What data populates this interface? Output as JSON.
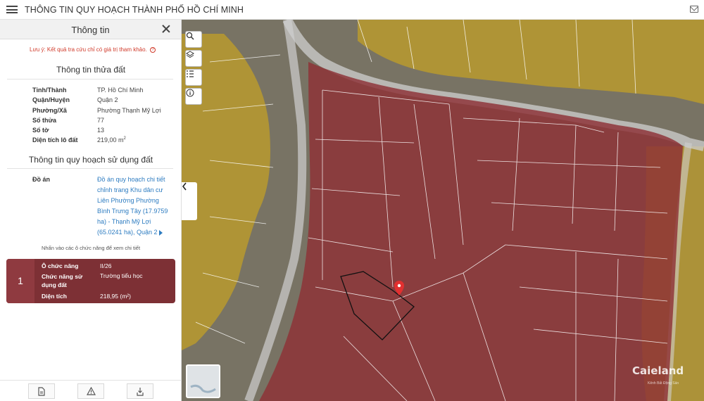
{
  "header": {
    "title": "THÔNG TIN QUY HOẠCH THÀNH PHỐ HỒ CHÍ MINH"
  },
  "panel": {
    "title": "Thông tin",
    "note": "Lưu ý: Kết quả tra cứu chỉ có giá trị tham khảo.",
    "parcel_section_title": "Thông tin thửa đất",
    "parcel": {
      "province_label": "Tỉnh/Thành",
      "province": "TP. Hồ Chí Minh",
      "district_label": "Quận/Huyện",
      "district": "Quận 2",
      "ward_label": "Phường/Xã",
      "ward": "Phường Thạnh Mỹ Lợi",
      "parcel_no_label": "Số thửa",
      "parcel_no": "77",
      "sheet_no_label": "Số tờ",
      "sheet_no": "13",
      "area_label": "Diện tích lô đất",
      "area": "219,00 m",
      "area_unit_sup": "2"
    },
    "plan_section_title": "Thông tin quy hoạch sử dụng đất",
    "plan_label": "Đồ án",
    "plan_link": "Đồ án quy hoạch chi tiết chỉnh trang Khu dân cư Liên Phường Phường Bình Trưng Tây (17.9759 ha) - Thạnh Mỹ Lợi (65.0241 ha), Quận 2",
    "hint": "Nhấn vào các ô chức năng để xem chi tiết",
    "function_card": {
      "index": "1",
      "cell_label": "Ô chức năng",
      "cell_value": "II/26",
      "use_label": "Chức năng sử dụng đất",
      "use_value": "Trường tiểu học",
      "area_label": "Diện tích",
      "area_value": "218,95 (m²)"
    },
    "footer": [
      "document-icon",
      "warning-icon",
      "download-icon"
    ]
  },
  "map": {
    "tools": [
      "search-icon",
      "layers-icon",
      "legend-icon",
      "info-icon"
    ],
    "watermark": "Caieland",
    "watermark_sub": "Kênh Bất Động Sản",
    "colors": {
      "overlay_red": "#8e3136",
      "overlay_yellow": "#b99a2e",
      "boundary": "#ffffff",
      "pin": "#e23030"
    }
  }
}
